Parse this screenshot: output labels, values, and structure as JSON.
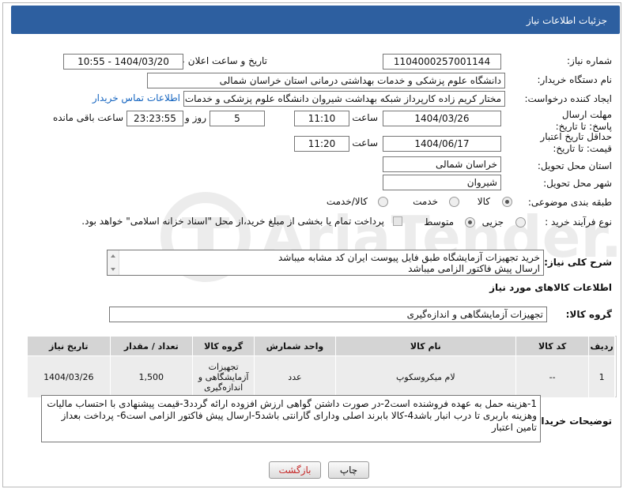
{
  "header": {
    "title": "جزئیات اطلاعات نیاز"
  },
  "need_number": {
    "label": "شماره نیاز:",
    "value": "1104000257001144"
  },
  "announce": {
    "label": "تاریخ و ساعت اعلان عمومی:",
    "value": "1404/03/20 - 10:55"
  },
  "buyer_org": {
    "label": "نام دستگاه خریدار:",
    "value": "دانشگاه علوم پزشکی و خدمات بهداشتی درمانی استان خراسان شمالی"
  },
  "creator": {
    "label": "ایجاد کننده درخواست:",
    "value": "مختار کریم زاده کارپرداز شبکه بهداشت شیروان دانشگاه علوم پزشکی و خدمات",
    "contact_link": "اطلاعات تماس خریدار"
  },
  "deadline": {
    "label": "مهلت ارسال پاسخ: تا تاریخ:",
    "date": "1404/03/26",
    "time_label": "ساعت",
    "time": "11:10",
    "days": "5",
    "days_label": "روز و",
    "remaining": "23:23:55",
    "remaining_label": "ساعت باقی مانده"
  },
  "price_validity": {
    "label": "حداقل تاریخ اعتبار قیمت: تا تاریخ:",
    "date": "1404/06/17",
    "time_label": "ساعت",
    "time": "11:20"
  },
  "delivery_province": {
    "label": "استان محل تحویل:",
    "value": "خراسان شمالی"
  },
  "delivery_city": {
    "label": "شهر محل تحویل:",
    "value": "شیروان"
  },
  "category": {
    "label": "طبقه بندی موضوعی:",
    "options": [
      "کالا",
      "خدمت",
      "کالا/خدمت"
    ],
    "selected": "کالا"
  },
  "process": {
    "label": "نوع فرآیند خرید :",
    "options": [
      "جزیی",
      "متوسط"
    ],
    "selected": "متوسط",
    "payment_note": "پرداخت تمام یا بخشی از مبلغ خرید،از محل \"اسناد خزانه اسلامی\" خواهد بود."
  },
  "description": {
    "label": "شرح کلی نیاز:",
    "line1": "خرید تجهیزات آزمایشگاه طبق فایل پیوست ایران کد مشابه میباشد",
    "line2": "ارسال پیش فاکتور الزامی میباشد"
  },
  "goods_section": {
    "title": "اطلاعات کالاهای مورد نیاز"
  },
  "goods_group": {
    "label": "گروه کالا:",
    "value": "تجهیزات آزمایشگاهی و اندازه‌گیری"
  },
  "table": {
    "headers": [
      "ردیف",
      "کد کالا",
      "نام کالا",
      "واحد شمارش",
      "گروه کالا",
      "تعداد / مقدار",
      "تاریخ نیاز"
    ],
    "rows": [
      {
        "row": "1",
        "code": "--",
        "name": "لام میکروسکوپ",
        "unit": "عدد",
        "group": "تجهیزات آزمایشگاهی و اندازه‌گیری",
        "qty": "1,500",
        "date": "1404/03/26"
      }
    ]
  },
  "buyer_notes": {
    "label": "توضیحات خریدار:",
    "text": "1-هزینه حمل به عهده فروشنده است2-در صورت داشتن گواهی ارزش افزوده ارائه گردد3-قیمت پیشنهادی با احتساب مالیات وهزینه باربری تا درب انبار  باشد4-کالا بابرند اصلی ودارای گارانتی باشد5-ارسال پیش فاکتور الزامی است6- پرداخت بعداز تامین اعتبار"
  },
  "buttons": {
    "print": "چاپ",
    "back": "بازگشت"
  },
  "colors": {
    "header_bg": "#2d5fa0",
    "link": "#1565c0",
    "back_text": "#c62828"
  }
}
